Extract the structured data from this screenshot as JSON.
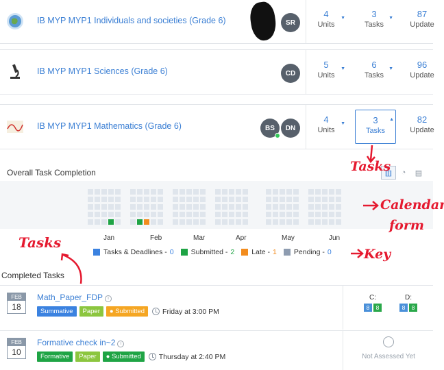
{
  "courses": [
    {
      "title": "IB MYP MYP1 Individuals and societies (Grade 6)",
      "avatars": [
        {
          "initials": "SR"
        }
      ],
      "units": "4",
      "units_label": "Units",
      "tasks": "3",
      "tasks_label": "Tasks",
      "updates": "87",
      "updates_label": "Update"
    },
    {
      "title": "IB MYP MYP1 Sciences (Grade 6)",
      "avatars": [
        {
          "initials": "CD"
        }
      ],
      "units": "5",
      "units_label": "Units",
      "tasks": "6",
      "tasks_label": "Tasks",
      "updates": "96",
      "updates_label": "Update"
    },
    {
      "title": "IB MYP MYP1 Mathematics (Grade 6)",
      "avatars": [
        {
          "initials": "BS"
        },
        {
          "initials": "DN"
        }
      ],
      "units": "4",
      "units_label": "Units",
      "tasks": "3",
      "tasks_label": "Tasks",
      "updates": "82",
      "updates_label": "Update"
    }
  ],
  "overall": {
    "title": "Overall Task Completion",
    "months": [
      "Jan",
      "Feb",
      "Mar",
      "Apr",
      "May",
      "Jun"
    ],
    "legend": [
      {
        "label": "Tasks & Deadlines -",
        "count": "0",
        "color": "#3b82e0"
      },
      {
        "label": "Submitted -",
        "count": "2",
        "color": "#1fa445"
      },
      {
        "label": "Late -",
        "count": "1",
        "color": "#f28c1e"
      },
      {
        "label": "Pending -",
        "count": "0",
        "color": "#8e9cb0"
      }
    ]
  },
  "completed": {
    "title": "Completed Tasks",
    "tasks": [
      {
        "month": "FEB",
        "day": "18",
        "name": "Math_Paper_FDP",
        "tags": [
          {
            "label": "Summative",
            "color": "#3b82e0"
          },
          {
            "label": "Paper",
            "color": "#8cc63f"
          },
          {
            "label": "Submitted",
            "color": "#f5a623"
          }
        ],
        "due": "Friday at 3:00 PM",
        "criteria": [
          {
            "label": "C:",
            "a": "8",
            "b": "8"
          },
          {
            "label": "D:",
            "a": "8",
            "b": "8"
          }
        ]
      },
      {
        "month": "FEB",
        "day": "10",
        "name": "Formative check in~2",
        "tags": [
          {
            "label": "Formative",
            "color": "#1fa445"
          },
          {
            "label": "Paper",
            "color": "#8cc63f"
          },
          {
            "label": "Submitted",
            "color": "#1fa445"
          }
        ],
        "due": "Thursday at 2:40 PM",
        "not_assessed": "Not Assessed Yet"
      }
    ]
  },
  "annotations": {
    "tasks_top": "Tasks",
    "calendar_line1": "Calendar",
    "calendar_line2": "form",
    "tasks_left": "Tasks",
    "key": "Key"
  }
}
